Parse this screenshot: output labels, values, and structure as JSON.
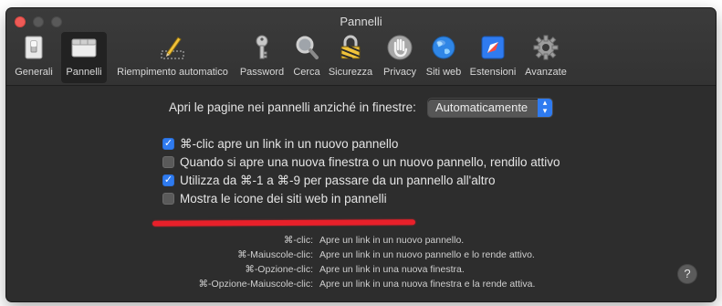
{
  "window": {
    "title": "Pannelli"
  },
  "toolbar": {
    "items": [
      {
        "label": "Generali",
        "icon": "general-switch-icon"
      },
      {
        "label": "Pannelli",
        "icon": "tabs-icon",
        "selected": true
      },
      {
        "label": "Riempimento automatico",
        "icon": "pencil-icon"
      },
      {
        "label": "Password",
        "icon": "key-icon"
      },
      {
        "label": "Cerca",
        "icon": "magnifier-icon"
      },
      {
        "label": "Sicurezza",
        "icon": "padlock-icon"
      },
      {
        "label": "Privacy",
        "icon": "hand-icon"
      },
      {
        "label": "Siti web",
        "icon": "globe-icon"
      },
      {
        "label": "Estensioni",
        "icon": "puzzle-compass-icon"
      },
      {
        "label": "Avanzate",
        "icon": "gear-icon"
      }
    ]
  },
  "open_pages": {
    "label": "Apri le pagine nei pannelli anziché in finestre:",
    "selected": "Automaticamente"
  },
  "options": [
    {
      "label": "⌘-clic apre un link in un nuovo pannello",
      "checked": true
    },
    {
      "label": "Quando si apre una nuova finestra o un nuovo pannello, rendilo attivo",
      "checked": false
    },
    {
      "label": "Utilizza da ⌘-1 a ⌘-9 per passare da un pannello all'altro",
      "checked": true
    },
    {
      "label": "Mostra le icone dei siti web in pannelli",
      "checked": false
    }
  ],
  "shortcuts": [
    {
      "key": "⌘-clic:",
      "desc": "Apre un link in un nuovo pannello."
    },
    {
      "key": "⌘-Maiuscole-clic:",
      "desc": "Apre un link in un nuovo pannello e lo rende attivo."
    },
    {
      "key": "⌘-Opzione-clic:",
      "desc": "Apre un link in una nuova finestra."
    },
    {
      "key": "⌘-Opzione-Maiuscole-clic:",
      "desc": "Apre un link in una nuova finestra e la rende attiva."
    }
  ],
  "help": {
    "label": "?"
  },
  "colors": {
    "accent": "#2f7bf0",
    "annotation": "#e8202a",
    "background": "#2d2d2d"
  }
}
